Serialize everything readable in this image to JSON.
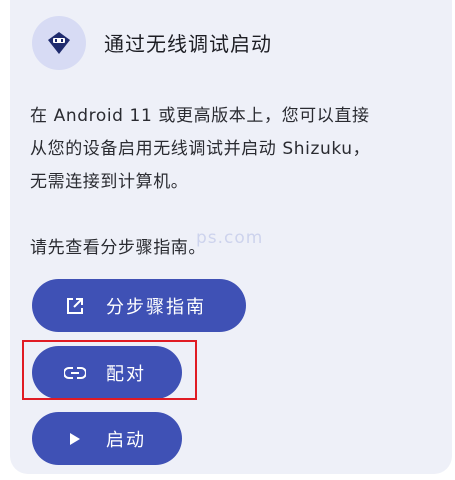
{
  "card": {
    "title": "通过无线调试启动",
    "paragraph1_line1": "在 Android 11 或更高版本上，您可以直接",
    "paragraph1_line2": "从您的设备启用无线调试并启动 Shizuku，",
    "paragraph1_line3": "无需连接到计算机。",
    "paragraph2": "请先查看分步骤指南。"
  },
  "buttons": {
    "guide": "分步骤指南",
    "pair": "配对",
    "start": "启动"
  },
  "watermark": "ps.com",
  "colors": {
    "card_bg": "#eef0f8",
    "accent": "#3f51b5",
    "icon_bg": "#d7dbf4",
    "highlight": "#e01b24"
  },
  "icons": {
    "header": "shizuku-icon",
    "guide": "open-in-new-icon",
    "pair": "link-icon",
    "start": "play-icon"
  }
}
